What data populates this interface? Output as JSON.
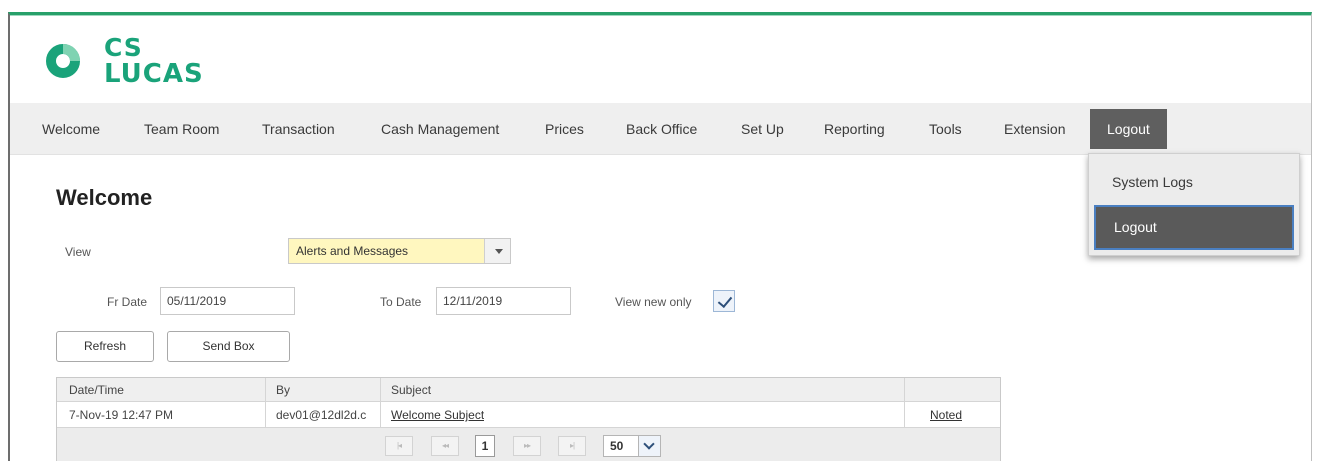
{
  "brand": {
    "line1": "CS",
    "line2": "LUCAS",
    "color": "#1aa37a"
  },
  "nav": {
    "items": [
      "Welcome",
      "Team Room",
      "Transaction",
      "Cash Management",
      "Prices",
      "Back Office",
      "Set Up",
      "Reporting",
      "Tools",
      "Extension",
      "Logout"
    ],
    "active": "Logout"
  },
  "dropdown": {
    "items": [
      "System Logs",
      "Logout"
    ],
    "selected": "Logout"
  },
  "page": {
    "title": "Welcome"
  },
  "filters": {
    "view_label": "View",
    "view_value": "Alerts and Messages",
    "from_label": "Fr Date",
    "from_value": "05/11/2019",
    "to_label": "To Date",
    "to_value": "12/11/2019",
    "new_only_label": "View new only",
    "new_only_checked": true
  },
  "buttons": {
    "refresh": "Refresh",
    "send_box": "Send Box"
  },
  "grid": {
    "columns": [
      "Date/Time",
      "By",
      "Subject",
      ""
    ],
    "rows": [
      {
        "datetime": "7-Nov-19 12:47 PM",
        "by": "dev01@12dl2d.c",
        "subject": "Welcome Subject",
        "action": "Noted"
      }
    ],
    "pager": {
      "first": "|◂",
      "prev": "◂◂",
      "page": "1",
      "next": "▸▸",
      "last": "▸|",
      "page_size": "50"
    }
  }
}
